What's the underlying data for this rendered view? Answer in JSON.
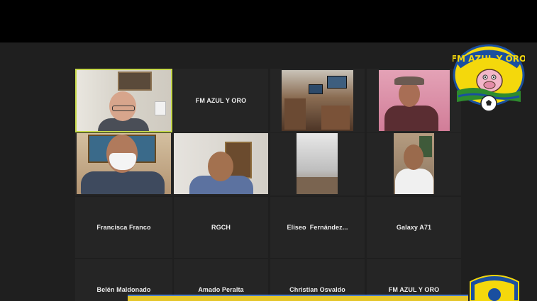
{
  "colors": {
    "active_speaker": "#c6d84a",
    "tile_bg": "#252525",
    "stage_bg": "#1f1f1f",
    "logo_yellow": "#f4d80c",
    "logo_blue": "#1a4fa0",
    "logo_green": "#2e8b2e"
  },
  "tiles": {
    "row1": {
      "participant_2": {
        "name": "FM AZUL Y ORO"
      }
    },
    "row3": [
      {
        "name": "Francisca Franco"
      },
      {
        "name": "RGCH"
      },
      {
        "name": "Eliseo  Fernández..."
      },
      {
        "name": "Galaxy A71"
      }
    ],
    "row4": [
      {
        "name": "Belén Maldonado"
      },
      {
        "name": "Amado Peralta"
      },
      {
        "name": "Christian Osvaldo"
      },
      {
        "name": "FM AZUL Y ORO"
      }
    ]
  },
  "logo": {
    "text": "FM AZUL Y ORO",
    "icon": "mascot-icon"
  }
}
